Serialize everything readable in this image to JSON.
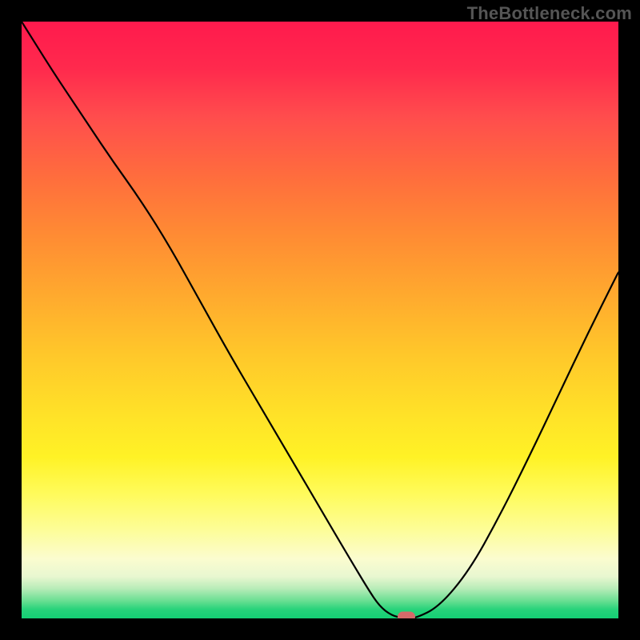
{
  "watermark": "TheBottleneck.com",
  "colors": {
    "frame": "#000000",
    "curve": "#000000",
    "marker": "#d46a6a"
  },
  "chart_data": {
    "type": "line",
    "title": "",
    "xlabel": "",
    "ylabel": "",
    "xlim": [
      0,
      100
    ],
    "ylim": [
      0,
      100
    ],
    "grid": false,
    "legend": false,
    "series": [
      {
        "name": "bottleneck-curve",
        "x": [
          0,
          5,
          10,
          15,
          20,
          25,
          30,
          35,
          40,
          45,
          50,
          55,
          58,
          60,
          62,
          64,
          66,
          70,
          75,
          80,
          85,
          90,
          95,
          100
        ],
        "y": [
          100,
          92,
          84.5,
          77,
          70,
          62,
          53,
          44,
          35.5,
          27,
          18.5,
          10,
          5,
          2,
          0.5,
          0,
          0,
          2,
          8,
          17,
          27,
          37.5,
          48,
          58
        ]
      }
    ],
    "marker": {
      "x": 64.5,
      "y": 0
    },
    "gradient_stops": [
      {
        "pos": 0,
        "color": "#ff1a4d"
      },
      {
        "pos": 0.36,
        "color": "#ff8c33"
      },
      {
        "pos": 0.66,
        "color": "#ffe228"
      },
      {
        "pos": 0.9,
        "color": "#fbfccf"
      },
      {
        "pos": 1.0,
        "color": "#14cf74"
      }
    ]
  }
}
